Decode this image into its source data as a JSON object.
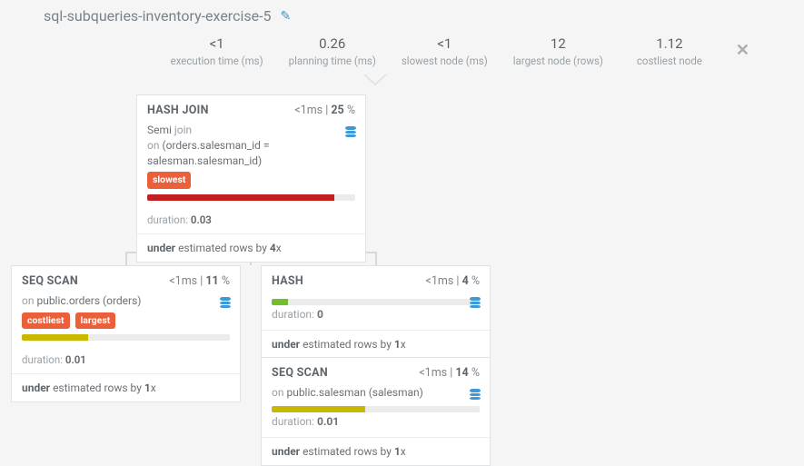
{
  "title": "sql-subqueries-inventory-exercise-5",
  "edit_icon": "✎",
  "close_icon": "✕",
  "metrics": {
    "exec": {
      "value": "<1",
      "label": "execution time (ms)"
    },
    "plan": {
      "value": "0.26",
      "label": "planning time (ms)"
    },
    "slowest": {
      "value": "<1",
      "label": "slowest node (ms)"
    },
    "largest": {
      "value": "12",
      "label": "largest node (rows)"
    },
    "cost": {
      "value": "1.12",
      "label": "costliest node"
    }
  },
  "nodes": {
    "hashjoin": {
      "title": "HASH JOIN",
      "ms": "<1ms",
      "pct": "25",
      "line1a": "Semi",
      "line1b": "join",
      "line2a": "on",
      "line2b": "(orders.salesman_id = salesman.salesman_id)",
      "badges": [
        "slowest"
      ],
      "bar_pct": 90,
      "duration_label": "duration:",
      "duration_value": "0.03",
      "footer_a": "under",
      "footer_b": "estimated rows by",
      "footer_c": "4",
      "footer_d": "x"
    },
    "seqorders": {
      "title": "SEQ SCAN",
      "ms": "<1ms",
      "pct": "11",
      "on_a": "on",
      "on_b": "public.orders (orders)",
      "badges": [
        "costliest",
        "largest"
      ],
      "bar_pct": 32,
      "duration_label": "duration:",
      "duration_value": "0.01",
      "footer_a": "under",
      "footer_b": "estimated rows by",
      "footer_c": "1",
      "footer_d": "x"
    },
    "hash": {
      "title": "HASH",
      "ms": "<1ms",
      "pct": "4",
      "bar_pct": 8,
      "duration_label": "duration:",
      "duration_value": "0",
      "footer_a": "under",
      "footer_b": "estimated rows by",
      "footer_c": "1",
      "footer_d": "x"
    },
    "seqsales": {
      "title": "SEQ SCAN",
      "ms": "<1ms",
      "pct": "14",
      "on_a": "on",
      "on_b": "public.salesman (salesman)",
      "bar_pct": 45,
      "duration_label": "duration:",
      "duration_value": "0.01",
      "footer_a": "under",
      "footer_b": "estimated rows by",
      "footer_c": "1",
      "footer_d": "x"
    }
  }
}
